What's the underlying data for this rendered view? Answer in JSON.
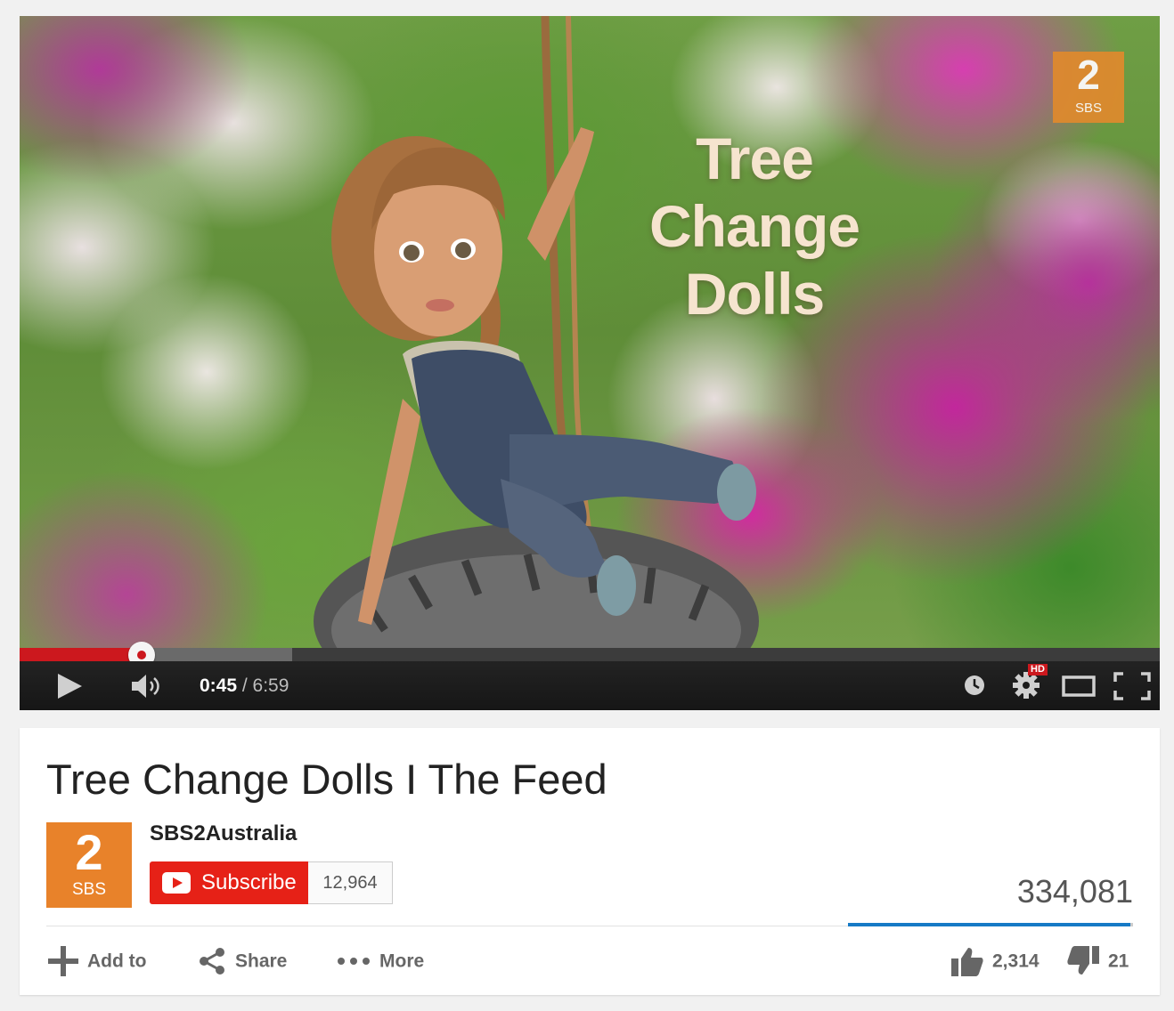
{
  "video": {
    "overlay_title_lines": [
      "Tree",
      "Change",
      "Dolls"
    ],
    "watermark": {
      "number": "2",
      "label": "SBS"
    }
  },
  "player": {
    "current_time": "0:45",
    "time_separator": " / ",
    "duration": "6:59",
    "progress_fraction": 0.107,
    "buffered_fraction": 0.239,
    "hd_badge": "HD",
    "colors": {
      "progress": "#cc181e",
      "controls_bg": "#1b1b1b"
    }
  },
  "info": {
    "title": "Tree Change Dolls I The Feed",
    "channel": {
      "name": "SBS2Australia",
      "avatar_number": "2",
      "avatar_label": "SBS",
      "avatar_color": "#e8822a"
    },
    "subscribe_label": "Subscribe",
    "subscriber_count": "12,964",
    "view_count": "334,081",
    "like_fraction": 0.991,
    "actions": {
      "add_to": "Add to",
      "share": "Share",
      "more": "More"
    },
    "likes": "2,314",
    "dislikes": "21",
    "colors": {
      "subscribe": "#e62117",
      "like_bar": "#167ac6"
    }
  }
}
